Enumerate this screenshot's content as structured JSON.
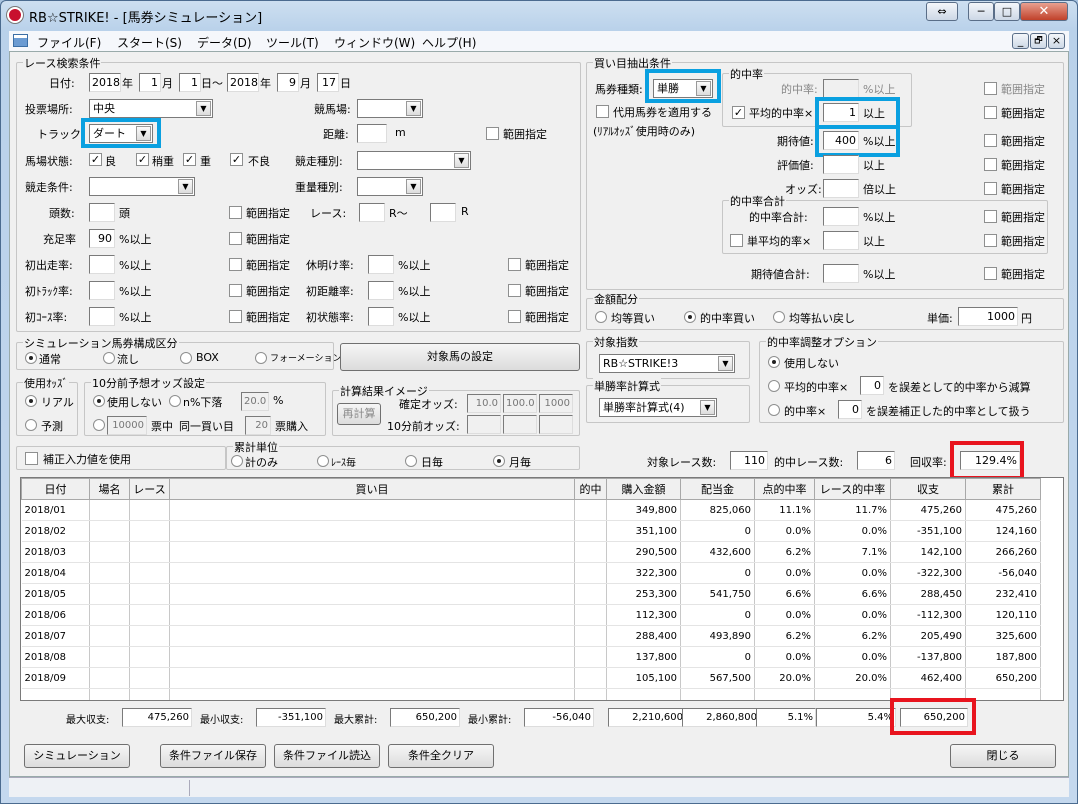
{
  "window": {
    "title": "RB☆STRIKE! - [馬券シミュレーション]",
    "buttons": {
      "minimize": "─",
      "maximize": "□",
      "close": "✕",
      "restore": "⇔"
    }
  },
  "menu": [
    "ファイル(F)",
    "スタート(S)",
    "データ(D)",
    "ツール(T)",
    "ウィンドウ(W)",
    "ヘルプ(H)"
  ],
  "mdi": {
    "min": "_",
    "restore": "🗗",
    "close": "×"
  },
  "race": {
    "group": "レース検索条件",
    "date_label": "日付:",
    "date_from": {
      "year": "2018",
      "year_u": "年",
      "month": "1",
      "month_u": "月",
      "day": "1",
      "day_u": "日～"
    },
    "date_to": {
      "year": "2018",
      "year_u": "年",
      "month": "9",
      "month_u": "月",
      "day": "17",
      "day_u": "日"
    },
    "venue_label": "投票場所:",
    "venue": "中央",
    "track_place_label": "競馬場:",
    "track_place": "",
    "track_label": "トラック",
    "track": "ダート",
    "distance_label": "距離:",
    "distance": "",
    "distance_unit": "m",
    "range": "範囲指定",
    "cond_label": "馬場状態:",
    "cond": [
      {
        "label": "良",
        "checked": true
      },
      {
        "label": "稍重",
        "checked": true
      },
      {
        "label": "重",
        "checked": true
      },
      {
        "label": "不良",
        "checked": true
      }
    ],
    "kind_label": "競走種別:",
    "kind": "",
    "race_cond_label": "競走条件:",
    "race_cond": "",
    "weight_label": "重量種別:",
    "weight": "",
    "heads_label": "頭数:",
    "heads": "",
    "heads_unit": "頭",
    "race_no_label": "レース:",
    "race_from": "",
    "race_from_u": "R～",
    "race_to": "",
    "race_to_u": "R",
    "fill_label": "充足率",
    "fill": "90",
    "fill_unit": "%以上",
    "rows": [
      {
        "a_label": "初出走率:",
        "a_val": "",
        "a_unit": "%以上",
        "b_label": "休明け率:",
        "b_val": "",
        "b_unit": "%以上"
      },
      {
        "a_label": "初ﾄﾗｯｸ率:",
        "a_val": "",
        "a_unit": "%以上",
        "b_label": "初距離率:",
        "b_val": "",
        "b_unit": "%以上"
      },
      {
        "a_label": "初ｺｰｽ率:",
        "a_val": "",
        "a_unit": "%以上",
        "b_label": "初状態率:",
        "b_val": "",
        "b_unit": "%以上"
      }
    ]
  },
  "bet": {
    "group": "買い目抽出条件",
    "type_label": "馬券種類:",
    "type": "単勝",
    "proxy": "代用馬券を適用する",
    "proxy_note": "(ﾘｱﾙｵｯｽﾞ使用時のみ)",
    "hit_group": "的中率",
    "hit_label": "的中率:",
    "hit_unit": "%以上",
    "avg_label": "平均的中率×",
    "avg": "1",
    "avg_unit": "以上",
    "exp_label": "期待値:",
    "exp": "400",
    "exp_unit": "%以上",
    "eval_label": "評価値:",
    "eval_unit": "以上",
    "odds_label": "オッズ:",
    "odds_unit": "倍以上",
    "sum_group": "的中率合計",
    "sum_label": "的中率合計:",
    "sum_unit": "%以上",
    "single_label": "単平均的率×",
    "single_unit": "以上",
    "exp_sum_label": "期待値合計:",
    "exp_sum_unit": "%以上",
    "range": "範囲指定"
  },
  "money": {
    "group": "金額配分",
    "opts": [
      "均等買い",
      "的中率買い",
      "均等払い戻し"
    ],
    "price_label": "単価:",
    "price": "1000",
    "price_unit": "円"
  },
  "index": {
    "group": "対象指数",
    "value": "RB☆STRIKE!3"
  },
  "calc": {
    "group": "単勝率計算式",
    "value": "単勝率計算式(4)"
  },
  "adj": {
    "group": "的中率調整オプション",
    "opts": [
      "使用しない",
      "平均的中率×",
      "的中率×"
    ],
    "v1": "0",
    "v1_text": "を誤差として的中率から減算",
    "v2": "0",
    "v2_text": "を誤差補正した的中率として扱う"
  },
  "sim": {
    "group": "シミュレーション馬券構成区分",
    "opts": [
      "通常",
      "流し",
      "BOX",
      "フォーメーション"
    ],
    "target_btn": "対象馬の設定"
  },
  "odds": {
    "group": "使用ｵｯｽﾞ",
    "opts": [
      "リアル",
      "予測"
    ]
  },
  "pre10": {
    "group": "10分前予想オッズ設定",
    "opt1": "使用しない",
    "opt2": "n%下落",
    "pct": "20.0",
    "pct_u": "%",
    "votes": "10000",
    "votes_u": "票中",
    "same_label": "同一買い目",
    "same": "20",
    "same_u": "票購入"
  },
  "image": {
    "group": "計算結果イメージ",
    "recalc": "再計算",
    "fixed_label": "確定オッズ:",
    "fixed": [
      "10.0",
      "100.0",
      "1000"
    ],
    "before_label": "10分前オッズ:"
  },
  "correction": "補正入力値を使用",
  "unit": {
    "group": "累計単位",
    "opts": [
      "計のみ",
      "ﾚｰｽ毎",
      "日毎",
      "月毎"
    ]
  },
  "summary": {
    "races_label": "対象レース数:",
    "races": "110",
    "hits_label": "的中レース数:",
    "hits": "6",
    "recov_label": "回収率:",
    "recov": "129.4%"
  },
  "table": {
    "headers": [
      "日付",
      "場名",
      "レース",
      "買い目",
      "的中",
      "購入金額",
      "配当金",
      "点的中率",
      "レース的中率",
      "収支",
      "累計"
    ],
    "rows": [
      [
        "2018/01",
        "",
        "",
        "",
        "",
        "349,800",
        "825,060",
        "11.1%",
        "11.7%",
        "475,260",
        "475,260"
      ],
      [
        "2018/02",
        "",
        "",
        "",
        "",
        "351,100",
        "0",
        "0.0%",
        "0.0%",
        "-351,100",
        "124,160"
      ],
      [
        "2018/03",
        "",
        "",
        "",
        "",
        "290,500",
        "432,600",
        "6.2%",
        "7.1%",
        "142,100",
        "266,260"
      ],
      [
        "2018/04",
        "",
        "",
        "",
        "",
        "322,300",
        "0",
        "0.0%",
        "0.0%",
        "-322,300",
        "-56,040"
      ],
      [
        "2018/05",
        "",
        "",
        "",
        "",
        "253,300",
        "541,750",
        "6.6%",
        "6.6%",
        "288,450",
        "232,410"
      ],
      [
        "2018/06",
        "",
        "",
        "",
        "",
        "112,300",
        "0",
        "0.0%",
        "0.0%",
        "-112,300",
        "120,110"
      ],
      [
        "2018/07",
        "",
        "",
        "",
        "",
        "288,400",
        "493,890",
        "6.2%",
        "6.2%",
        "205,490",
        "325,600"
      ],
      [
        "2018/08",
        "",
        "",
        "",
        "",
        "137,800",
        "0",
        "0.0%",
        "0.0%",
        "-137,800",
        "187,800"
      ],
      [
        "2018/09",
        "",
        "",
        "",
        "",
        "105,100",
        "567,500",
        "20.0%",
        "20.0%",
        "462,400",
        "650,200"
      ]
    ]
  },
  "totals": {
    "max_label": "最大収支:",
    "max": "475,260",
    "min_label": "最小収支:",
    "min": "-351,100",
    "maxc_label": "最大累計:",
    "maxc": "650,200",
    "minc_label": "最小累計:",
    "minc": "-56,040",
    "buy": "2,210,600",
    "pay": "2,860,800",
    "pt": "5.1%",
    "rc": "5.4%",
    "total": "650,200"
  },
  "buttons": {
    "sim": "シミュレーション",
    "save": "条件ファイル保存",
    "load": "条件ファイル読込",
    "clear": "条件全クリア",
    "close": "閉じる"
  },
  "colors": {
    "highlight_blue": "#0aa0e0",
    "highlight_red": "#e8141e"
  }
}
